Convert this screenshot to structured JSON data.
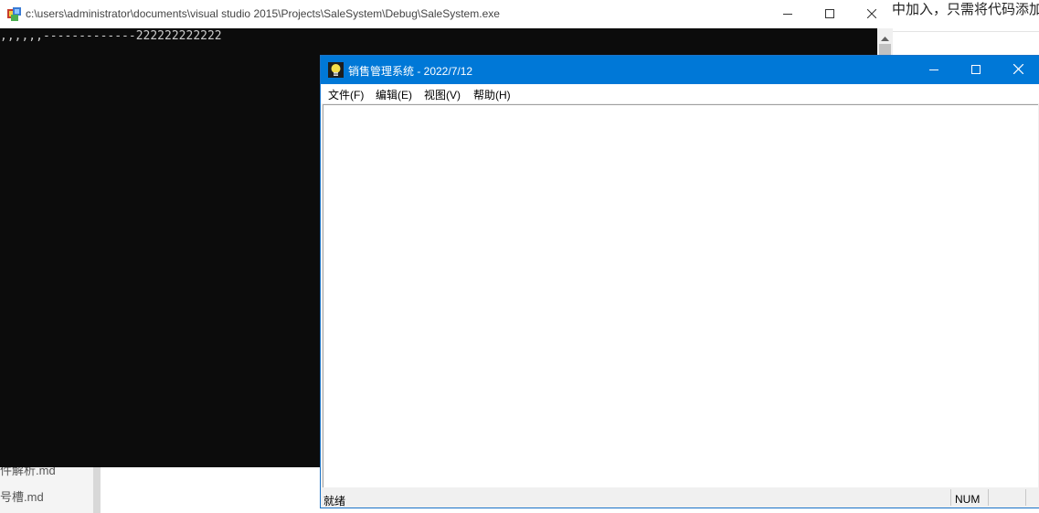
{
  "background": {
    "top_text": "中加入，只需将代码添加",
    "files": [
      "件解析.md",
      "号槽.md"
    ]
  },
  "console": {
    "title": "c:\\users\\administrator\\documents\\visual studio 2015\\Projects\\SaleSystem\\Debug\\SaleSystem.exe",
    "output_line": ",,,,,,-------------222222222222"
  },
  "app": {
    "title": "销售管理系统 - 2022/7/12",
    "menu": [
      "文件(F)",
      "编辑(E)",
      "视图(V)",
      "帮助(H)"
    ],
    "status": {
      "text": "就绪",
      "num": "NUM"
    }
  },
  "icons": {
    "console": "console-app-icon",
    "app": "bulb-app-icon",
    "minimize": "minimize-icon",
    "maximize": "maximize-icon",
    "close": "close-icon"
  },
  "colors": {
    "titlebar_active": "#0078d7",
    "console_bg": "#0c0c0c",
    "console_text": "#cccccc"
  }
}
